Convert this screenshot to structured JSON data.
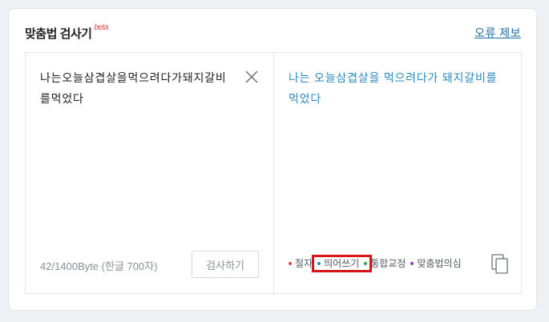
{
  "header": {
    "title": "맞춤법 검사기",
    "beta_label": "beta",
    "report_link": "오류 제보"
  },
  "input": {
    "text": "나는오늘삼겹살을먹으려다가돼지갈비를먹었다",
    "byte_count": "42/1400Byte (한글 700자)",
    "check_button": "검사하기"
  },
  "result": {
    "text": "나는 오늘삼겹살을 먹으려다가 돼지갈비를 먹었다",
    "legend": [
      {
        "label": "철자",
        "color": "#e0463e"
      },
      {
        "label": "띄어쓰기",
        "color": "#2b8cc4"
      },
      {
        "label": "통합교정",
        "color": "#2fa84f"
      },
      {
        "label": "맞춤법의심",
        "color": "#8a3fbf"
      }
    ]
  },
  "icons": {
    "clear": "close-icon",
    "copy": "copy-icon"
  }
}
